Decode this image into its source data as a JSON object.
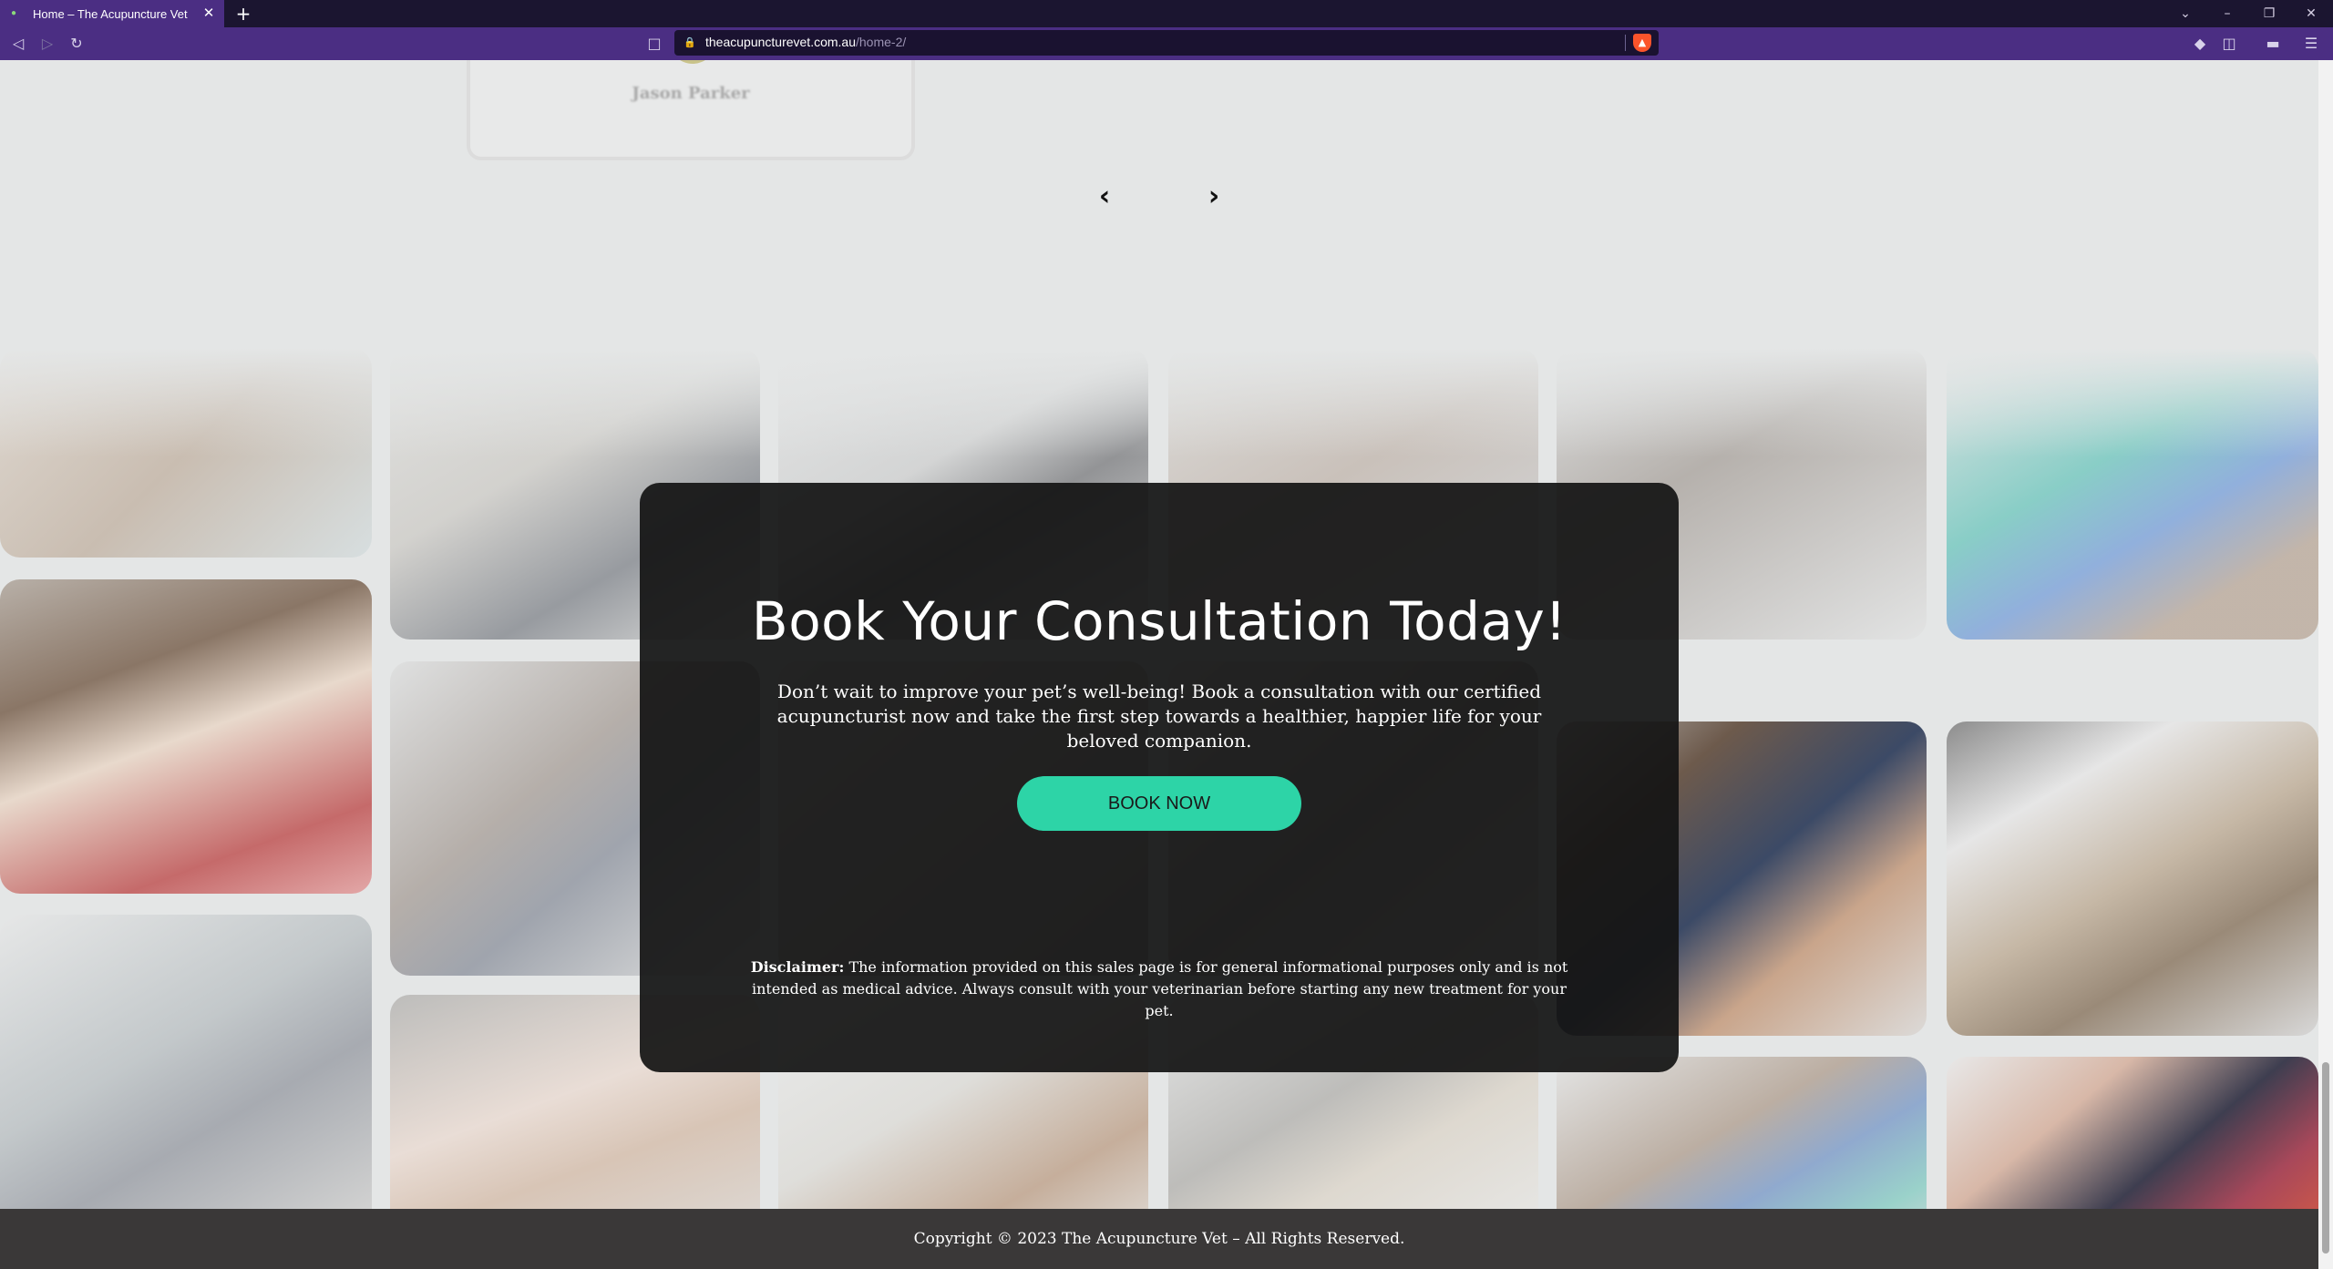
{
  "browser": {
    "tab_title": "Home – The Acupuncture Vet",
    "url_host": "theacupuncturevet.com.au",
    "url_path": "/home-2/",
    "icons": [
      "back-icon",
      "forward-icon",
      "reload-icon",
      "bookmark-icon",
      "lock-icon",
      "brave-shield-icon",
      "extensions-icon",
      "sidebar-icon",
      "wallet-icon",
      "menu-icon"
    ]
  },
  "testimonial": {
    "author": "Jason Parker"
  },
  "carousel": {
    "prev_label": "‹",
    "next_label": "›"
  },
  "cta": {
    "heading": "Book Your Consultation Today!",
    "intro": "Don’t wait to improve your pet’s well-being! Book a consultation with our certified acupuncturist now and take the first step towards a healthier, happier life for your beloved companion.",
    "button_label": "BOOK NOW",
    "disclaimer_label": "Disclaimer:",
    "disclaimer_text": " The information provided on this sales page is for general informational purposes only and is not intended as medical advice. Always consult with your veterinarian before starting any new treatment for your pet."
  },
  "footer": {
    "copyright": "Copyright © 2023 The Acupuncture Vet – All Rights Reserved."
  },
  "colors": {
    "accent": "#2dd4a7",
    "browser_purple": "#4b2e83",
    "footer_bg": "#3a3838",
    "cta_bg": "#141414"
  }
}
